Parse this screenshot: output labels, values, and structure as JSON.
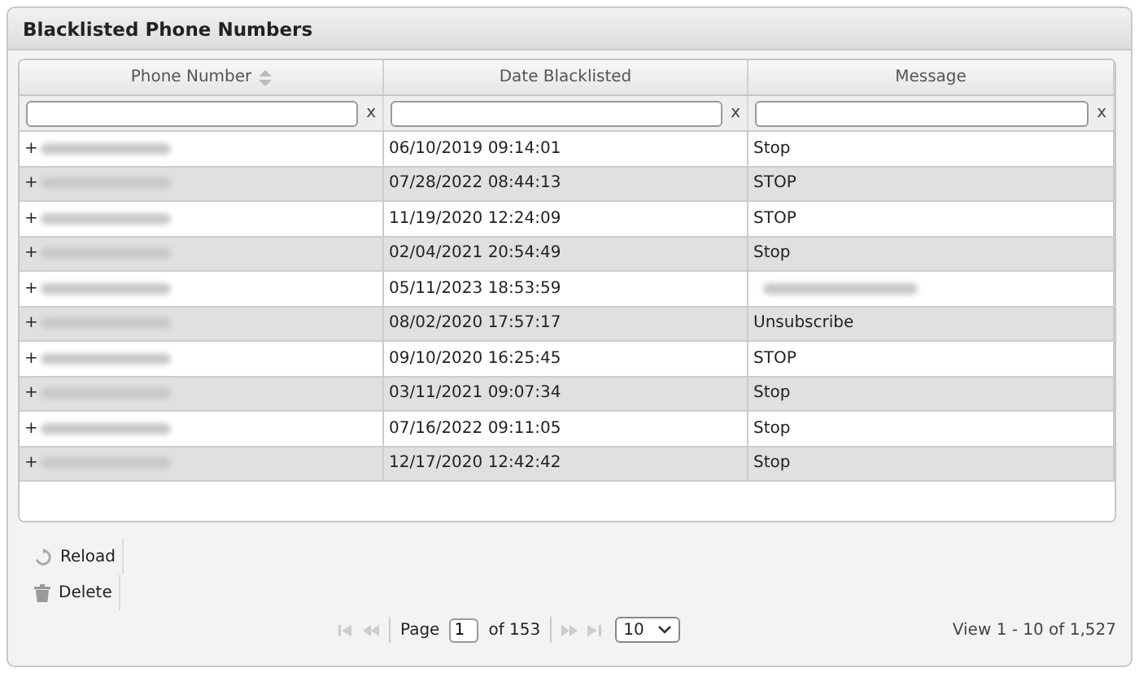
{
  "panel": {
    "title": "Blacklisted Phone Numbers"
  },
  "table": {
    "columns": [
      {
        "label": "Phone Number",
        "sortable": true,
        "filter_clear": "x"
      },
      {
        "label": "Date Blacklisted",
        "sortable": false,
        "filter_clear": "x"
      },
      {
        "label": "Message",
        "sortable": false,
        "filter_clear": "x"
      }
    ],
    "rows": [
      {
        "phone": "+",
        "date": "06/10/2019 09:14:01",
        "message": "Stop",
        "message_blurred": false
      },
      {
        "phone": "+",
        "date": "07/28/2022 08:44:13",
        "message": "STOP",
        "message_blurred": false
      },
      {
        "phone": "+",
        "date": "11/19/2020 12:24:09",
        "message": "STOP",
        "message_blurred": false
      },
      {
        "phone": "+",
        "date": "02/04/2021 20:54:49",
        "message": "Stop",
        "message_blurred": false
      },
      {
        "phone": "+",
        "date": "05/11/2023 18:53:59",
        "message_blurred": true
      },
      {
        "phone": "+",
        "date": "08/02/2020 17:57:17",
        "message": "Unsubscribe",
        "message_blurred": false
      },
      {
        "phone": "+",
        "date": "09/10/2020 16:25:45",
        "message": "STOP",
        "message_blurred": false
      },
      {
        "phone": "+",
        "date": "03/11/2021 09:07:34",
        "message": "Stop",
        "message_blurred": false
      },
      {
        "phone": "+",
        "date": "07/16/2022 09:11:05",
        "message": "Stop",
        "message_blurred": false
      },
      {
        "phone": "+",
        "date": "12/17/2020 12:42:42",
        "message": "Stop",
        "message_blurred": false
      }
    ]
  },
  "actions": [
    {
      "kind": "reload",
      "label": "Reload"
    },
    {
      "kind": "delete",
      "label": "Delete"
    }
  ],
  "pager": {
    "page_label": "Page",
    "page": "1",
    "of_label": "of 153",
    "page_size": "10",
    "view": "View 1 - 10 of 1,527"
  }
}
